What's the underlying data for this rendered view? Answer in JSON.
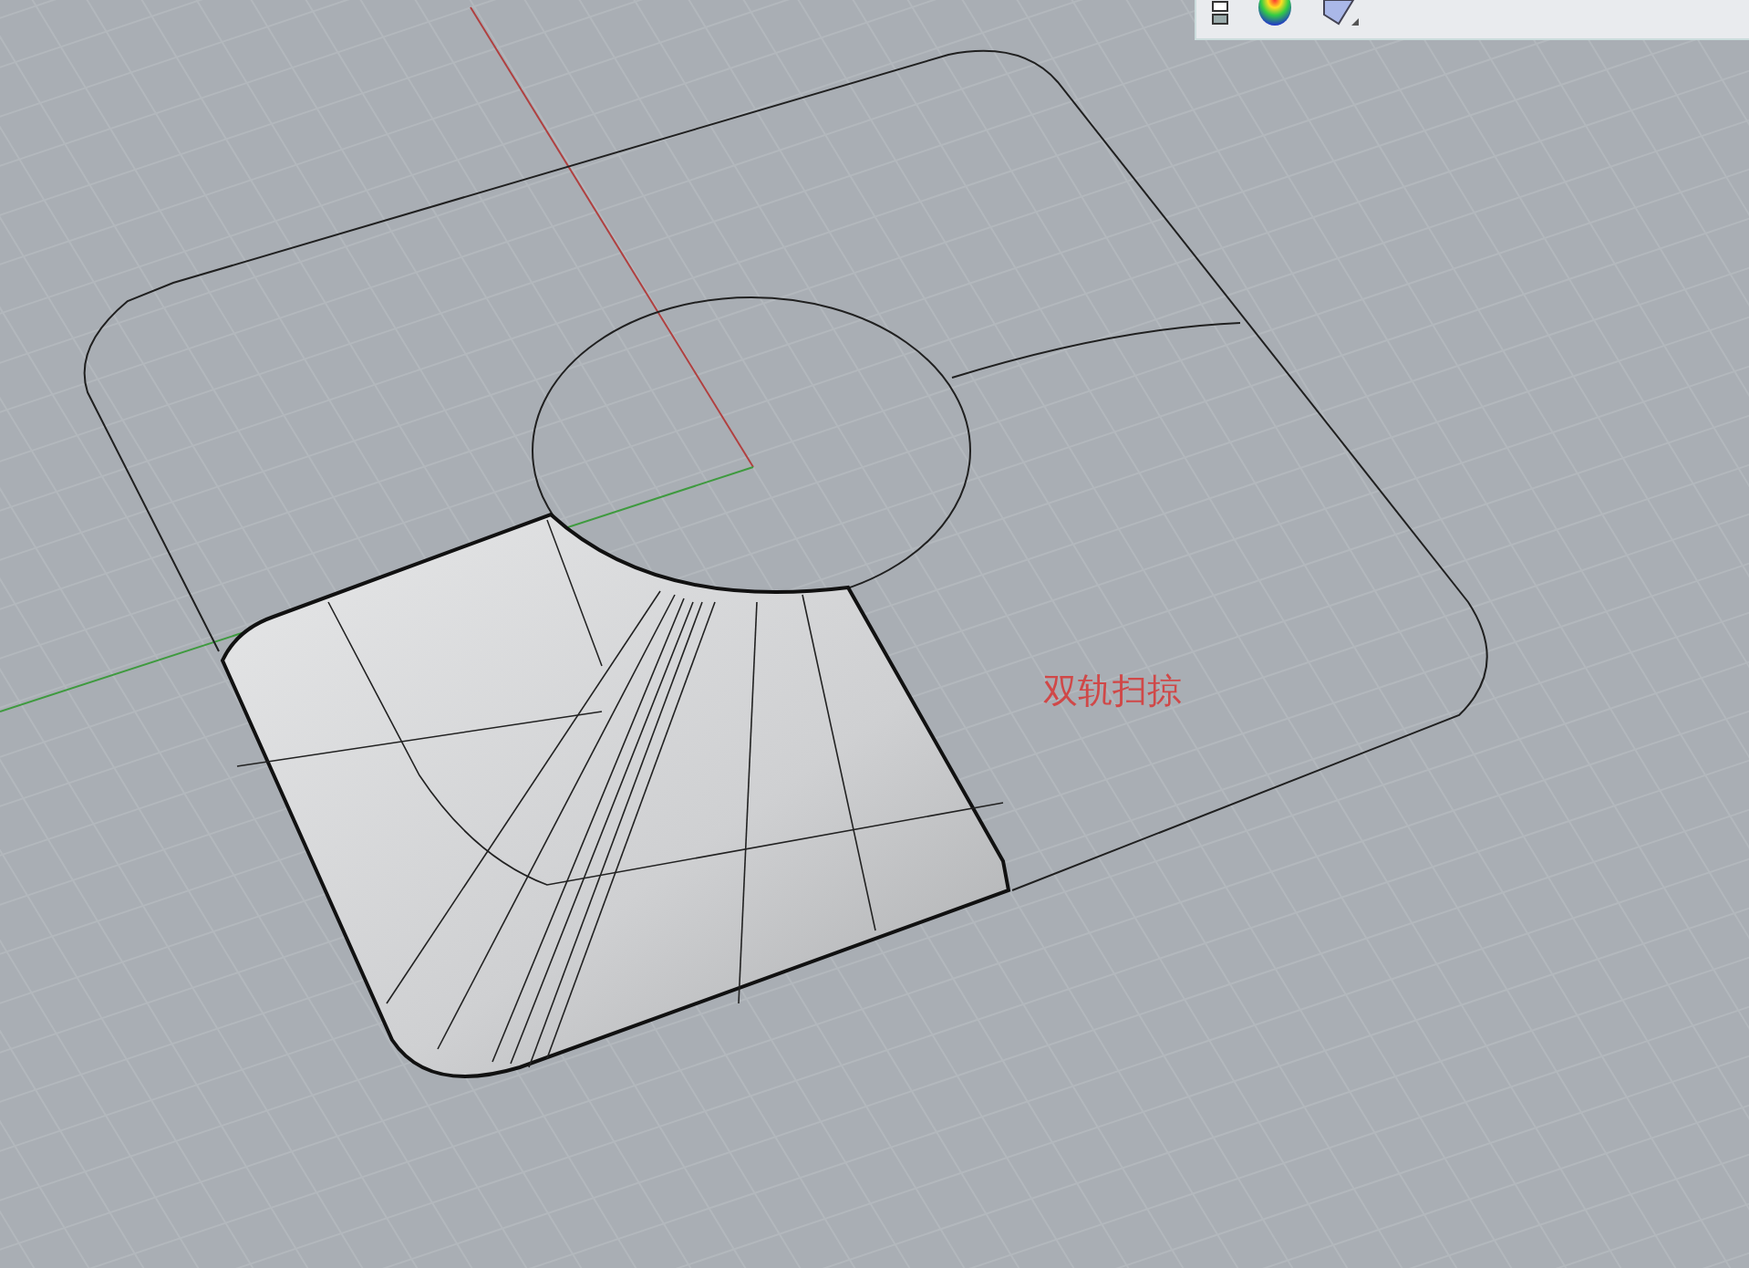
{
  "viewport": {
    "annotation": "双轨扫掠"
  }
}
